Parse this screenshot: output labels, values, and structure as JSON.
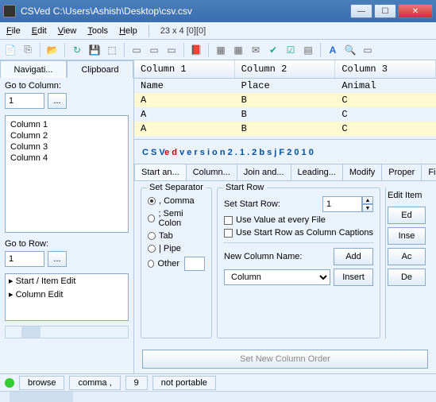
{
  "titlebar": {
    "title": "CSVed C:\\Users\\Ashish\\Desktop\\csv.csv"
  },
  "menu": {
    "file": "File",
    "edit": "Edit",
    "view": "View",
    "tools": "Tools",
    "help": "Help",
    "status": "23 x 4 [0][0]"
  },
  "sidebar": {
    "tab_nav": "Navigati...",
    "tab_clip": "Clipboard",
    "goto_col_label": "Go to Column:",
    "goto_col_val": "1",
    "goto_row_label": "Go to Row:",
    "goto_row_val": "1",
    "cols": [
      "Column 1",
      "Column 2",
      "Column 3",
      "Column 4"
    ],
    "tree": [
      "Start / Item Edit",
      "Column Edit"
    ]
  },
  "grid": {
    "headers": [
      "Column 1",
      "Column 2",
      "Column 3"
    ],
    "rows": [
      [
        "Name",
        "Place",
        "Animal"
      ],
      [
        "A",
        "B",
        "C"
      ],
      [
        "A",
        "B",
        "C"
      ],
      [
        "A",
        "B",
        "C"
      ]
    ]
  },
  "banner": {
    "p1": "C S V",
    "p2": "e d",
    "p3": "  v e r s i o n  2 . 1 . 2 b  s j F  2 0 1 0"
  },
  "subtabs": [
    "Start an...",
    "Column...",
    "Join and...",
    "Leading...",
    "Modify",
    "Proper",
    "Filter a..."
  ],
  "sep": {
    "legend": "Set Separator",
    "comma": ", Comma",
    "semi": "; Semi Colon",
    "tab": "Tab",
    "pipe": "| Pipe",
    "other": "Other",
    "other_val": ""
  },
  "start": {
    "legend": "Start Row",
    "setrow_label": "Set Start Row:",
    "setrow_val": "1",
    "use_every": "Use Value at every File",
    "use_caption": "Use Start Row as Column Captions",
    "newcol_label": "New Column Name:",
    "newcol_val": "Column",
    "add": "Add",
    "insert": "Insert"
  },
  "right": {
    "legend": "Edit Item",
    "b1": "Ed",
    "b2": "Inse",
    "b3": "Ac",
    "b4": "De"
  },
  "widebtn": "Set New Column Order",
  "status": {
    "browse": "browse",
    "comma": "comma ,",
    "char": "9",
    "port": "not portable"
  }
}
